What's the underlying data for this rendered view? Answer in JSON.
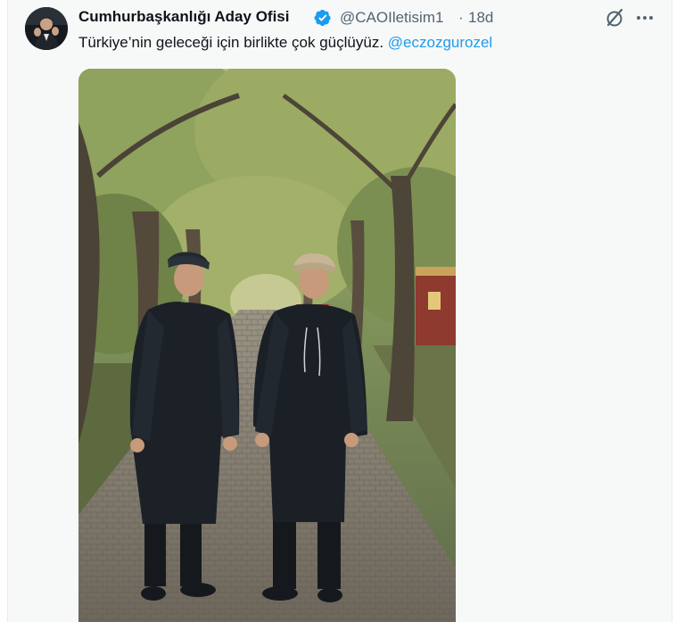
{
  "tweet": {
    "display_name": "Cumhurbaşkanlığı Aday Ofisi",
    "handle": "@CAOIletisim1",
    "separator": "·",
    "timestamp": "18d",
    "text": "Türkiye’nin geleceği için birlikte çok güçlüyüz.",
    "mention": "@eczozgurozel"
  },
  "icons": {
    "verified": "verified-badge-icon",
    "grok": "grok-icon",
    "more": "more-dots-icon"
  },
  "colors": {
    "link": "#1d9bf0",
    "verified": "#1d9bf0",
    "secondary_text": "#536471",
    "primary_text": "#0f1419"
  }
}
